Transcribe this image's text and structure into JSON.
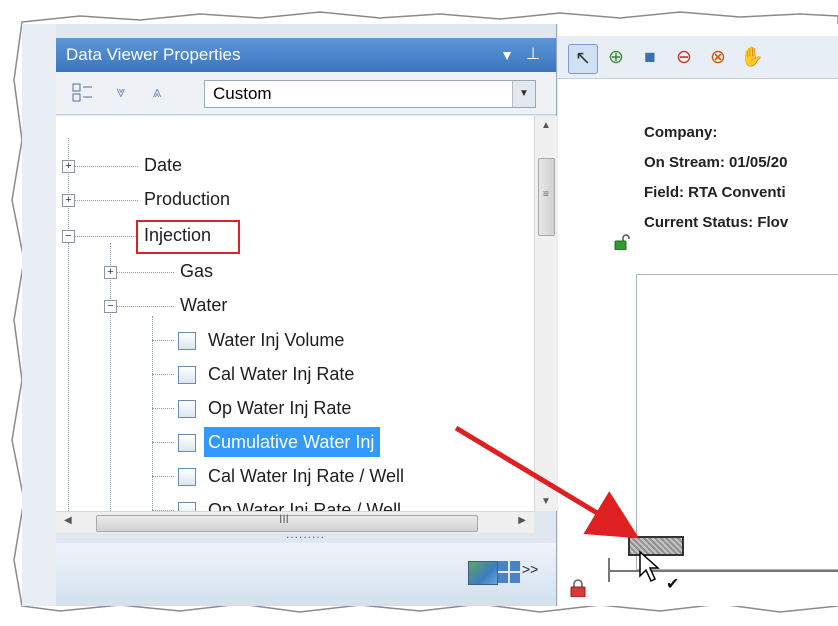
{
  "panel": {
    "title": "Data Viewer Properties",
    "dropdown_icon": "dropdown-arrow-icon",
    "pin_icon": "pin-icon"
  },
  "toolbar": {
    "icons": [
      "categorized-view-icon",
      "expand-all-icon",
      "collapse-all-icon"
    ],
    "select_value": "Custom"
  },
  "tree": {
    "date": "Date",
    "production": "Production",
    "injection": "Injection",
    "gas": "Gas",
    "water": "Water",
    "items": [
      "Water Inj Volume",
      "Cal Water Inj Rate",
      "Op Water Inj Rate",
      "Cumulative Water Inj",
      "Cal Water Inj Rate / Well",
      "Op Water Inj Rate / Well"
    ],
    "selected_item": "Cumulative Water Inj"
  },
  "hscroll": {
    "grip": "III"
  },
  "splitter": {
    "grip": "........."
  },
  "bottom_bar": {
    "overflow": ">>"
  },
  "right_panel": {
    "toolbar_icons": [
      "pointer-tool-icon",
      "zoom-in-icon",
      "select-rectangle-icon",
      "zoom-out-icon",
      "zoom-reset-icon",
      "pan-hand-icon"
    ],
    "company": "Company:",
    "on_stream": "On Stream: 01/05/20",
    "field": "Field: RTA Conventi",
    "current_status": "Current Status: Flov"
  },
  "colors": {
    "highlight_box": "#d8232a",
    "annotation_arrow": "#e02020",
    "selection": "#3399ff",
    "header": "#3b75bf"
  }
}
